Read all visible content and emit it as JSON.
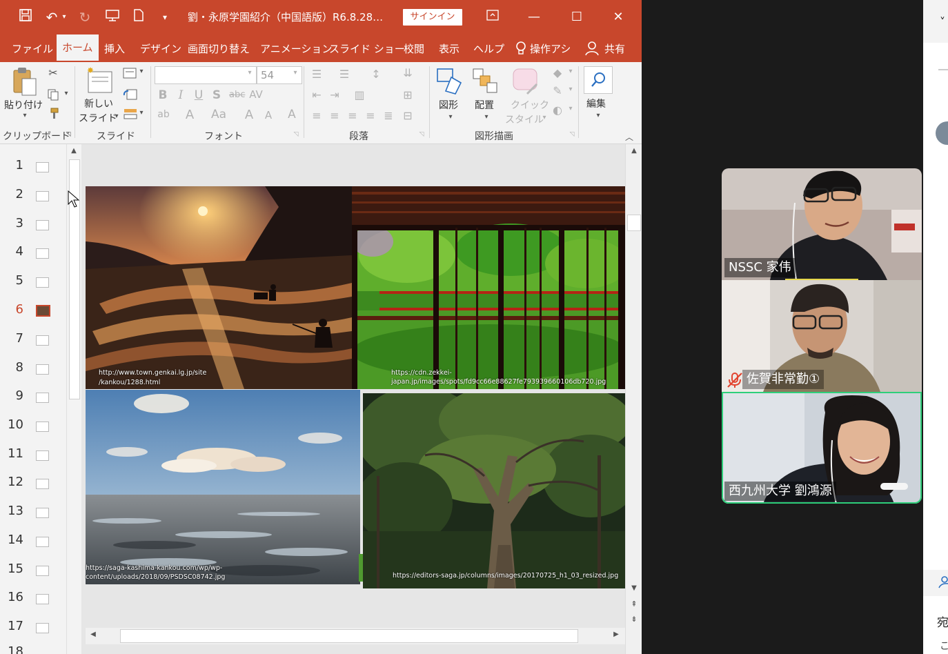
{
  "title_bar": {
    "doc_title": "劉・永原学園紹介（中国語版）R6.8.28…",
    "signin_label": "サインイン"
  },
  "tabs": [
    {
      "label": "ファイル"
    },
    {
      "label": "ホーム"
    },
    {
      "label": "挿入"
    },
    {
      "label": "デザイン"
    },
    {
      "label": "画面切り替え"
    },
    {
      "label": "アニメーション"
    },
    {
      "label": "スライド ショー"
    },
    {
      "label": "校閲"
    },
    {
      "label": "表示"
    },
    {
      "label": "ヘルプ"
    },
    {
      "label": "操作アシ"
    },
    {
      "label": "共有"
    }
  ],
  "ribbon": {
    "paste_label": "貼り付け",
    "new_slide_line1": "新しい",
    "new_slide_line2": "スライド",
    "font_size": "54",
    "shape_label": "図形",
    "arrange_label": "配置",
    "quick_style_line1": "クイック",
    "quick_style_line2": "スタイル",
    "edit_label": "編集",
    "groups": {
      "clipboard": "クリップボード",
      "slides": "スライド",
      "font": "フォント",
      "paragraph": "段落",
      "drawing": "図形描画"
    }
  },
  "slide_numbers": [
    "1",
    "2",
    "3",
    "4",
    "5",
    "6",
    "7",
    "8",
    "9",
    "10",
    "11",
    "12",
    "13",
    "14",
    "15",
    "16",
    "17",
    "18"
  ],
  "current_slide": "6",
  "slide": {
    "captions": {
      "terraces_1": "http://www.town.genkai.lg.jp/site",
      "terraces_2": "/kankou/1288.html",
      "temple_1": "https://cdn.zekkei-",
      "temple_2": "japan.jp/images/spots/fd9cc66e88627fe793939660106db720.jpg",
      "tidal_1": "https://saga-kashima-kankou.com/wp/wp-",
      "tidal_2": "content/uploads/2018/09/PSDSC08742.jpg",
      "forest": "https://editors-saga.jp/columns/images/20170725_h1_03_resized.jpg"
    }
  },
  "participants": [
    {
      "name": "NSSC 家伟",
      "muted": false
    },
    {
      "name": "佐賀非常勤①",
      "muted": true
    },
    {
      "name": "西九州大学  劉鴻源",
      "muted": false,
      "active_speaker": true
    }
  ],
  "side_panel": {
    "text_1": "宛",
    "text_2": "こ"
  },
  "colors": {
    "ppt_accent": "#c8472c",
    "active_speaker_border": "#2ecf7a",
    "muted_icon": "#e2442f"
  }
}
